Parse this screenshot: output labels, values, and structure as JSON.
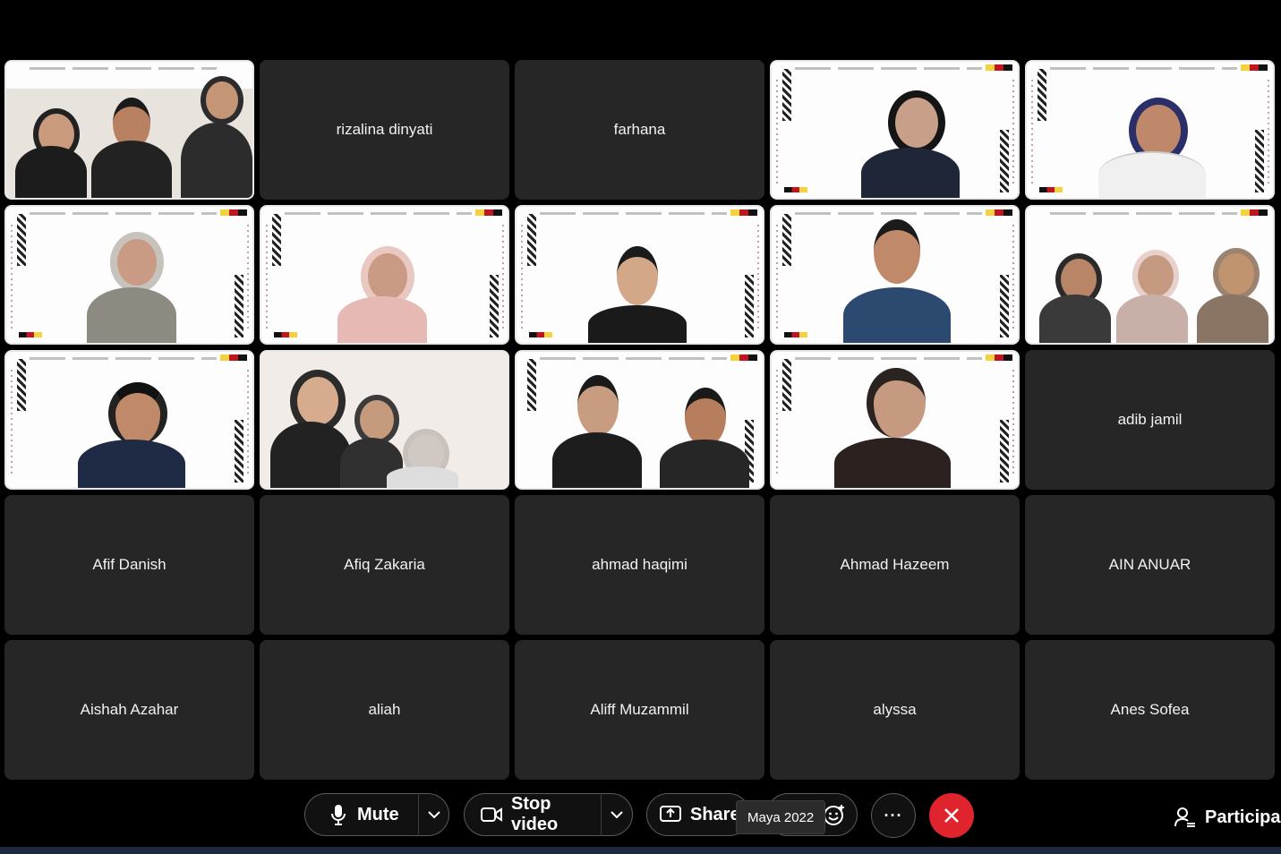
{
  "tiles": [
    {
      "name": "",
      "video": true
    },
    {
      "name": "rizalina dinyati",
      "video": false
    },
    {
      "name": "farhana",
      "video": false
    },
    {
      "name": "",
      "video": true
    },
    {
      "name": "",
      "video": true
    },
    {
      "name": "",
      "video": true
    },
    {
      "name": "",
      "video": true
    },
    {
      "name": "",
      "video": true
    },
    {
      "name": "",
      "video": true
    },
    {
      "name": "",
      "video": true
    },
    {
      "name": "",
      "video": true
    },
    {
      "name": "",
      "video": true
    },
    {
      "name": "",
      "video": true
    },
    {
      "name": "",
      "video": true
    },
    {
      "name": "adib jamil",
      "video": false
    },
    {
      "name": "Afif Danish",
      "video": false
    },
    {
      "name": "Afiq Zakaria",
      "video": false
    },
    {
      "name": "ahmad haqimi",
      "video": false
    },
    {
      "name": "Ahmad Hazeem",
      "video": false
    },
    {
      "name": "AIN ANUAR",
      "video": false
    },
    {
      "name": "Aishah Azahar",
      "video": false
    },
    {
      "name": "aliah",
      "video": false
    },
    {
      "name": "Aliff Muzammil",
      "video": false
    },
    {
      "name": "alyssa",
      "video": false
    },
    {
      "name": "Anes Sofea",
      "video": false
    }
  ],
  "controls": {
    "mute_label": "Mute",
    "stop_video_label": "Stop video",
    "share_label": "Share",
    "tooltip_text": "Maya 2022",
    "more_label": "···",
    "participants_label": "Participan"
  },
  "colors": {
    "tile_bg": "#262626",
    "end_call": "#e0242e",
    "accent_red": "#c0141e",
    "accent_yellow": "#f4d23b"
  },
  "icons": [
    "microphone-icon",
    "chevron-down-icon",
    "video-camera-icon",
    "share-screen-icon",
    "reactions-icon",
    "more-icon",
    "close-icon",
    "participants-icon"
  ]
}
